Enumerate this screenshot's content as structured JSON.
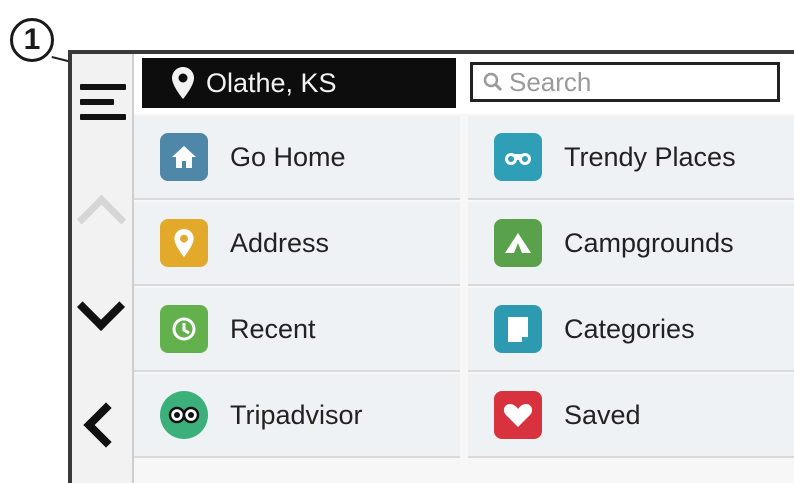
{
  "callout": {
    "number": "1"
  },
  "topbar": {
    "location": "Olathe, KS",
    "search_placeholder": "Search"
  },
  "categories": [
    {
      "label": "Go Home",
      "icon": "home-icon",
      "color": "#4f87a8"
    },
    {
      "label": "Trendy Places",
      "icon": "binoculars-icon",
      "color": "#2f9fb8"
    },
    {
      "label": "Address",
      "icon": "address-pin-icon",
      "color": "#e3a92a"
    },
    {
      "label": "Campgrounds",
      "icon": "tent-icon",
      "color": "#5aa14b"
    },
    {
      "label": "Recent",
      "icon": "history-icon",
      "color": "#63b14c"
    },
    {
      "label": "Categories",
      "icon": "categories-icon",
      "color": "#2e9ab1"
    },
    {
      "label": "Tripadvisor",
      "icon": "tripadvisor-icon",
      "color": "#3bb07a"
    },
    {
      "label": "Saved",
      "icon": "heart-icon",
      "color": "#d8323f"
    }
  ]
}
